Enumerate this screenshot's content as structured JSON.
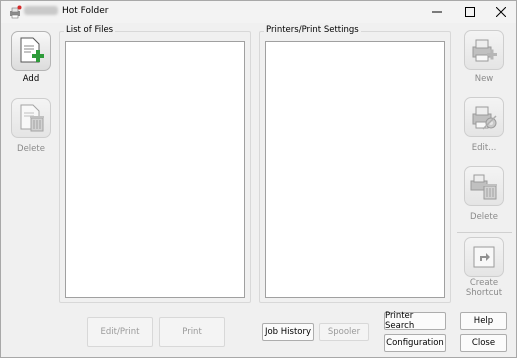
{
  "window": {
    "title": "Hot Folder",
    "controls": [
      "minimize",
      "maximize",
      "close"
    ]
  },
  "left_toolbar": {
    "add_label": "Add",
    "delete_label": "Delete"
  },
  "files_group": {
    "label": "List of Files"
  },
  "printers_group": {
    "label": "Printers/Print Settings"
  },
  "right_toolbar": {
    "new_label": "New",
    "edit_label": "Edit...",
    "delete_label": "Delete",
    "shortcut_label": "Create\nShortcut"
  },
  "bottom_buttons": {
    "edit_print": "Edit/Print",
    "print": "Print",
    "job_history": "Job History",
    "spooler": "Spooler",
    "printer_search": "Printer Search",
    "configuration": "Configuration",
    "help": "Help",
    "close": "Close"
  },
  "colors": {
    "add_plus": "#2e9b3a",
    "app_icon_red": "#d42a2a",
    "close_hover": "#c42b1c"
  }
}
